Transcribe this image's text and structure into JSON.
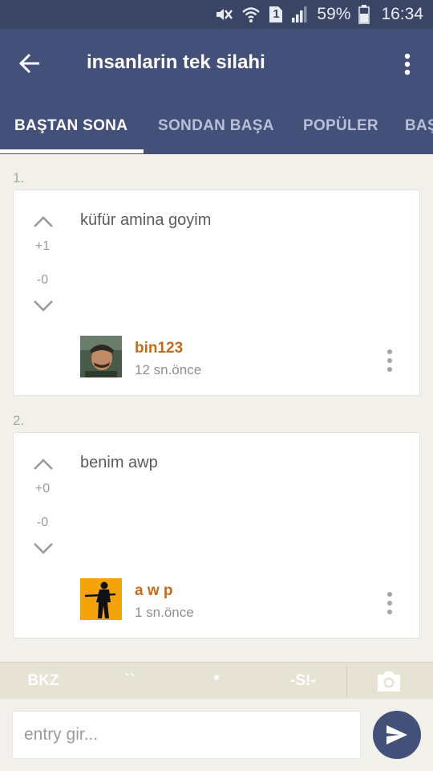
{
  "status_bar": {
    "battery_percent": "59%",
    "time": "16:34",
    "sim_slot": "1",
    "icons": [
      "mute-icon",
      "wifi-icon",
      "sim-icon",
      "signal-icon",
      "battery-icon"
    ]
  },
  "app_bar": {
    "title": "insanlarin tek silahi",
    "back_icon": "arrow-left-icon",
    "overflow_icon": "more-vertical-icon"
  },
  "tabs": [
    {
      "label": "BAŞTAN SONA",
      "active": true
    },
    {
      "label": "SONDAN BAŞA",
      "active": false
    },
    {
      "label": "POPÜLER",
      "active": false
    },
    {
      "label": "BAŞ",
      "active": false
    }
  ],
  "entries": [
    {
      "index": "1.",
      "upvotes": "+1",
      "downvotes": "-0",
      "text": "küfür amina goyim",
      "author": "bin123",
      "time": "12 sn.önce"
    },
    {
      "index": "2.",
      "upvotes": "+0",
      "downvotes": "-0",
      "text": "benim awp",
      "author": "a w p",
      "time": "1 sn.önce"
    }
  ],
  "format_bar": {
    "buttons": [
      "BKZ",
      "``",
      "*",
      "-S!-"
    ],
    "camera_icon": "camera-icon"
  },
  "composer": {
    "placeholder": "entry gir...",
    "value": "",
    "send_icon": "send-icon"
  },
  "colors": {
    "primary": "#43507a",
    "status_bar": "#3a4565",
    "author": "#c36a1b",
    "background": "#f1f0ea"
  }
}
